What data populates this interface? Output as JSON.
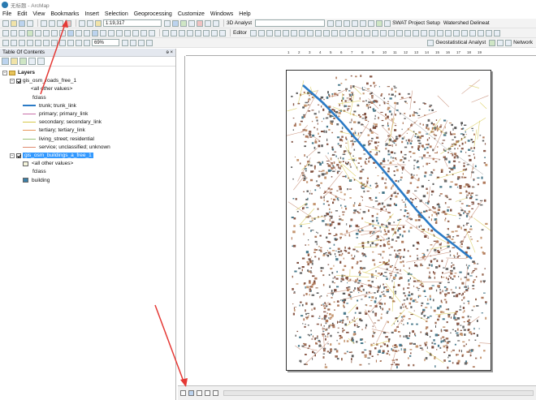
{
  "window": {
    "title": "无标题 - ArcMap"
  },
  "menu": [
    "File",
    "Edit",
    "View",
    "Bookmarks",
    "Insert",
    "Selection",
    "Geoprocessing",
    "Customize",
    "Windows",
    "Help"
  ],
  "toolbar": {
    "scale": "1:19,317",
    "analyst_3d": "3D Analyst",
    "swat": "SWAT Project Setup",
    "watershed": "Watershed Delineat",
    "editor": "Editor",
    "zoom": "69%",
    "geostat": "Geostatistical Analyst",
    "network": "Network"
  },
  "toc": {
    "title": "Table Of Contents",
    "pin": "ɘ ×",
    "root": "Layers",
    "layers": [
      {
        "name": "gis_osm_roads_free_1",
        "selected": false,
        "legend": [
          {
            "label": "<all other values>",
            "type": "none"
          },
          {
            "label": "fclass",
            "type": "none"
          },
          {
            "label": "trunk; trunk_link",
            "type": "line",
            "color": "#2b7bc6",
            "width": 2
          },
          {
            "label": "primary; primary_link",
            "type": "line",
            "color": "#c96fa8",
            "width": 1
          },
          {
            "label": "secondary; secondary_link",
            "type": "line",
            "color": "#d6c84a",
            "width": 1
          },
          {
            "label": "tertiary; tertiary_link",
            "type": "line",
            "color": "#e8965a",
            "width": 1
          },
          {
            "label": "living_street; residential",
            "type": "line",
            "color": "#9bc27a",
            "width": 1
          },
          {
            "label": "service; unclassified; unknown",
            "type": "line",
            "color": "#e08a6e",
            "width": 1
          }
        ]
      },
      {
        "name": "gis_osm_buildings_a_free_1",
        "selected": true,
        "legend": [
          {
            "label": "<all other values>",
            "type": "box",
            "color": "#f5f5dc"
          },
          {
            "label": "fclass",
            "type": "none"
          },
          {
            "label": "building",
            "type": "box",
            "color": "#3a7fa8"
          }
        ]
      }
    ]
  },
  "ruler_ticks": [
    "1",
    "2",
    "3",
    "4",
    "5",
    "6",
    "7",
    "8",
    "9",
    "10",
    "11",
    "12",
    "13",
    "14",
    "15",
    "16",
    "17",
    "18",
    "19"
  ],
  "colors": {
    "trunk": "#2b7bc6",
    "building": "#3a7fa8",
    "roads_secondary": "#d6c84a",
    "roads_other": "#c1836a",
    "arrow": "#e53935"
  }
}
